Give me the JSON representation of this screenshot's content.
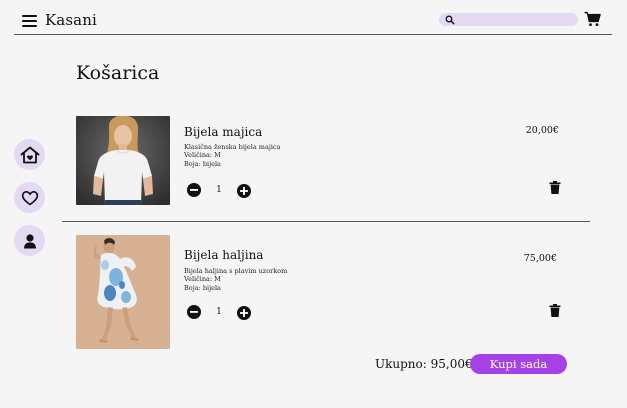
{
  "header": {
    "brand": "Kasani",
    "search_placeholder": ""
  },
  "page": {
    "title": "Košarica"
  },
  "items": [
    {
      "name": "Bijela majica",
      "description": "Klasična ženska bijela majica",
      "size": "Veličina: M",
      "color": "Boja: bijela",
      "quantity": "1",
      "price": "20,00€"
    },
    {
      "name": "Bijela haljina",
      "description": "Bijela haljina s plavim uzorkom",
      "size": "Veličina: M",
      "color": "Boja: bijela",
      "quantity": "1",
      "price": "75,00€"
    }
  ],
  "summary": {
    "total": "Ukupno: 95,00€",
    "buy_label": "Kupi sada"
  },
  "sidebar": {
    "items": [
      {
        "icon": "home-heart-icon"
      },
      {
        "icon": "heart-icon"
      },
      {
        "icon": "user-icon"
      }
    ]
  },
  "colors": {
    "accent": "#a541e5",
    "accent_light": "#e4d9f3",
    "background": "#f6f5f6"
  }
}
